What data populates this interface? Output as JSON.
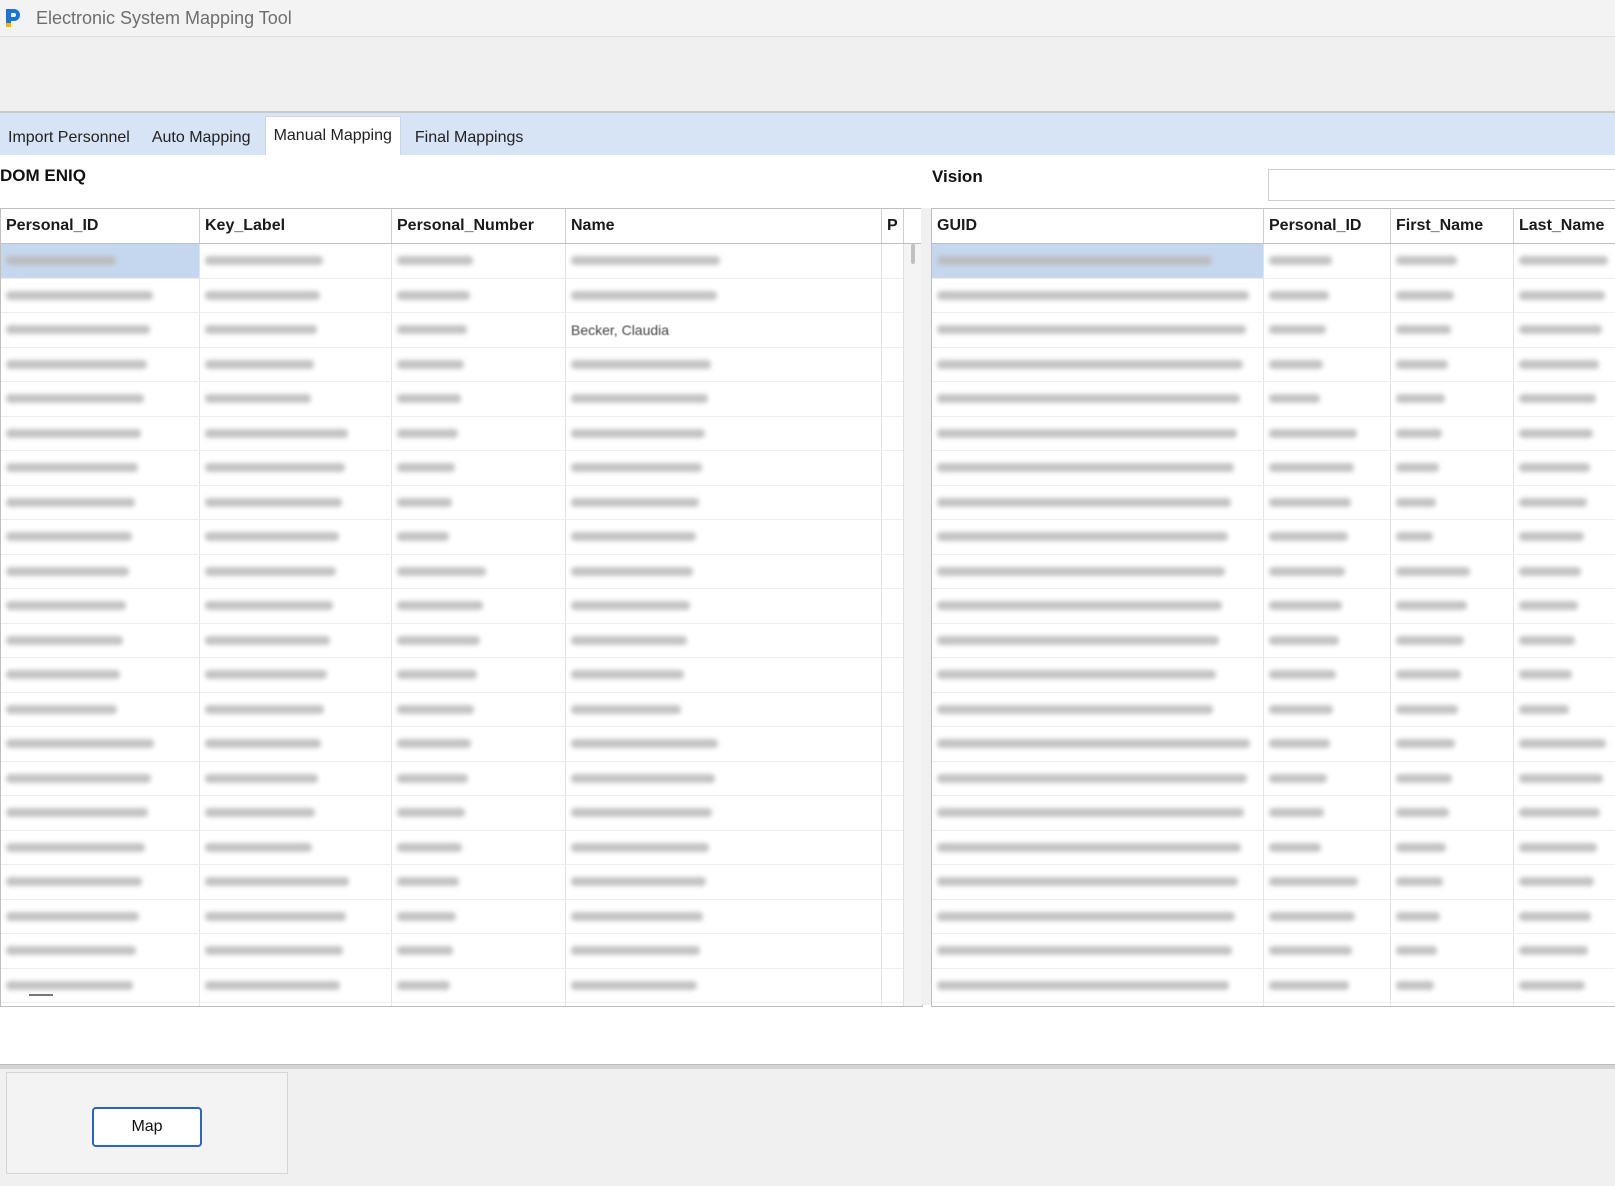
{
  "window": {
    "title": "Electronic System Mapping Tool",
    "logo_icon": "app-logo-icon",
    "accent": "#1e73d8"
  },
  "tabs": [
    {
      "label": "Import Personnel",
      "active": false
    },
    {
      "label": "Auto Mapping",
      "active": false
    },
    {
      "label": "Manual Mapping",
      "active": true
    },
    {
      "label": "Final Mappings",
      "active": false
    }
  ],
  "left_panel": {
    "label": "DOM ENIQ",
    "columns": [
      "Personal_ID",
      "Key_Label",
      "Personal_Number",
      "Name",
      "P"
    ],
    "visible_text": {
      "row": 2,
      "name": "Becker, Claudia"
    }
  },
  "right_panel": {
    "label": "Vision",
    "search": {
      "value": "",
      "placeholder": ""
    },
    "columns": [
      "GUID",
      "Personal_ID",
      "First_Name",
      "Last_Name"
    ]
  },
  "actions": {
    "map_label": "Map"
  }
}
